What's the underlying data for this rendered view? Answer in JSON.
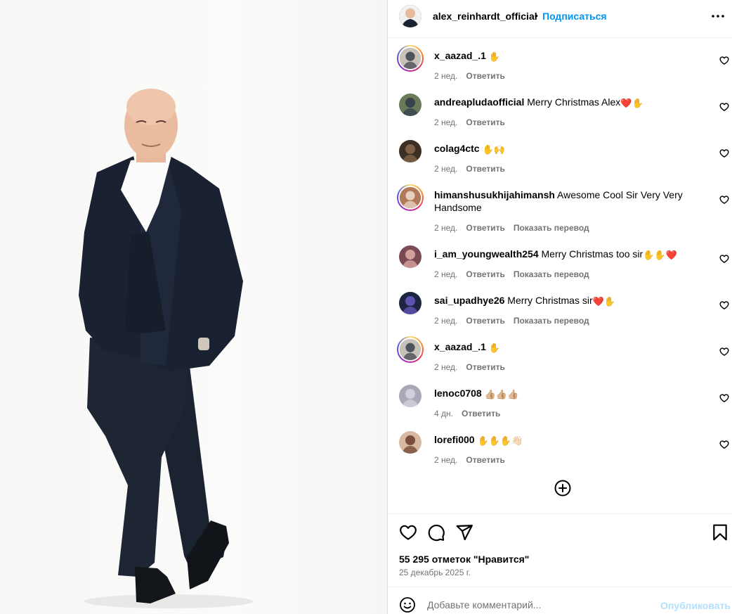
{
  "post": {
    "username": "alex_reinhardt_official",
    "separator": "•",
    "follow_label": "Подписаться",
    "more_label": "•••"
  },
  "comments": [
    {
      "user": "x_aazad_.1",
      "text": "",
      "emoji": "✋",
      "time": "2 нед.",
      "reply": "Ответить",
      "translate": "",
      "story_ring": true
    },
    {
      "user": "andreapludaofficial",
      "text": "Merry Christmas Alex",
      "emoji": "❤️✋",
      "time": "2 нед.",
      "reply": "Ответить",
      "translate": "",
      "story_ring": false
    },
    {
      "user": "colag4ctc",
      "text": "",
      "emoji": "✋🙌",
      "time": "2 нед.",
      "reply": "Ответить",
      "translate": "",
      "story_ring": false
    },
    {
      "user": "himanshusukhijahimansh",
      "text": "Awesome Cool Sir Very Very Handsome",
      "emoji": "",
      "time": "2 нед.",
      "reply": "Ответить",
      "translate": "Показать перевод",
      "story_ring": true
    },
    {
      "user": "i_am_youngwealth254",
      "text": "Merry Christmas too sir",
      "emoji": "✋✋❤️",
      "time": "2 нед.",
      "reply": "Ответить",
      "translate": "Показать перевод",
      "story_ring": false
    },
    {
      "user": "sai_upadhye26",
      "text": "Merry Christmas sir",
      "emoji": "❤️✋",
      "time": "2 нед.",
      "reply": "Ответить",
      "translate": "Показать перевод",
      "story_ring": false
    },
    {
      "user": "x_aazad_.1",
      "text": "",
      "emoji": "✋",
      "time": "2 нед.",
      "reply": "Ответить",
      "translate": "",
      "story_ring": true
    },
    {
      "user": "lenoc0708",
      "text": "",
      "emoji": "👍🏼👍🏼👍🏼",
      "time": "4 дн.",
      "reply": "Ответить",
      "translate": "",
      "story_ring": false
    },
    {
      "user": "lorefi000",
      "text": "",
      "emoji": "✋✋✋👋🏻",
      "time": "2 нед.",
      "reply": "Ответить",
      "translate": "",
      "story_ring": false
    }
  ],
  "likes_text": "55 295 отметок \"Нравится\"",
  "date_text": "25 декабрь 2025 г.",
  "add_comment": {
    "placeholder": "Добавьте комментарий...",
    "publish_label": "Опубликовать"
  },
  "colors": {
    "link_blue": "#0095f6",
    "publish_disabled": "#b2dffc",
    "muted_text": "#737373",
    "heart_red": "#c8102e"
  },
  "icons": {
    "like": "heart-icon",
    "comment": "comment-icon",
    "share": "paper-plane-icon",
    "save": "bookmark-icon",
    "load_more": "plus-circle-icon",
    "emoji": "smiley-icon"
  }
}
